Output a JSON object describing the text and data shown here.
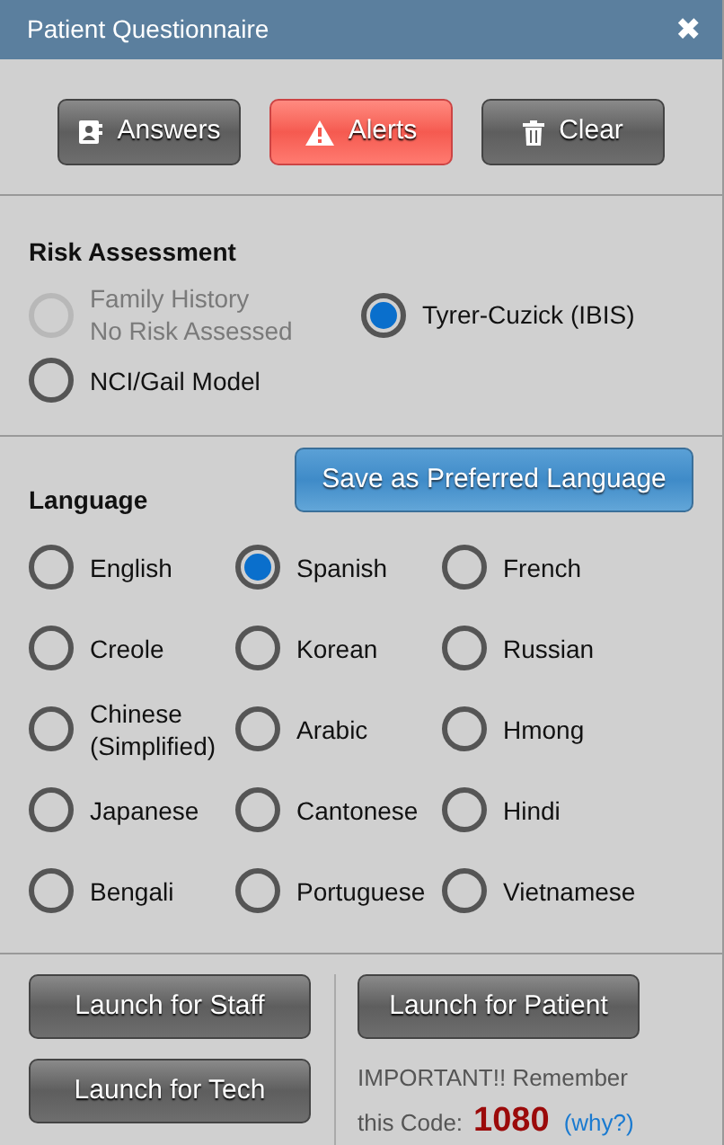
{
  "window": {
    "title": "Patient Questionnaire",
    "close": "✖"
  },
  "toolbar": [
    {
      "label": "Answers",
      "kind": "answers"
    },
    {
      "label": "Alerts",
      "kind": "alerts"
    },
    {
      "label": "Clear",
      "kind": "clear"
    }
  ],
  "risk_assessment": {
    "heading": "Risk Assessment",
    "options": [
      {
        "lines": [
          "Family History",
          "No Risk Assessed"
        ],
        "selected": false,
        "disabled": true
      },
      {
        "lines": [
          "Tyrer-Cuzick (IBIS)"
        ],
        "selected": true,
        "disabled": false
      },
      {
        "lines": [
          "NCI/Gail Model"
        ],
        "selected": false,
        "disabled": false
      }
    ]
  },
  "language": {
    "heading": "Language",
    "save_button": "Save as Preferred Language",
    "options": [
      {
        "lines": [
          "English"
        ],
        "selected": false
      },
      {
        "lines": [
          "Spanish"
        ],
        "selected": true
      },
      {
        "lines": [
          "French"
        ],
        "selected": false
      },
      {
        "lines": [
          "Creole"
        ],
        "selected": false
      },
      {
        "lines": [
          "Korean"
        ],
        "selected": false
      },
      {
        "lines": [
          "Russian"
        ],
        "selected": false
      },
      {
        "lines": [
          "Chinese",
          "(Simplified)"
        ],
        "selected": false
      },
      {
        "lines": [
          "Arabic"
        ],
        "selected": false
      },
      {
        "lines": [
          "Hmong"
        ],
        "selected": false
      },
      {
        "lines": [
          "Japanese"
        ],
        "selected": false
      },
      {
        "lines": [
          "Cantonese"
        ],
        "selected": false
      },
      {
        "lines": [
          "Hindi"
        ],
        "selected": false
      },
      {
        "lines": [
          "Bengali"
        ],
        "selected": false
      },
      {
        "lines": [
          "Portuguese"
        ],
        "selected": false
      },
      {
        "lines": [
          "Vietnamese"
        ],
        "selected": false
      }
    ]
  },
  "launch": {
    "staff_buttons": [
      "Launch for Staff",
      "Launch for Tech"
    ],
    "patient_button": "Launch for Patient",
    "note": "IMPORTANT!! Remember",
    "code_label": "this Code:",
    "code": "1080",
    "why_link": "(why?)"
  }
}
